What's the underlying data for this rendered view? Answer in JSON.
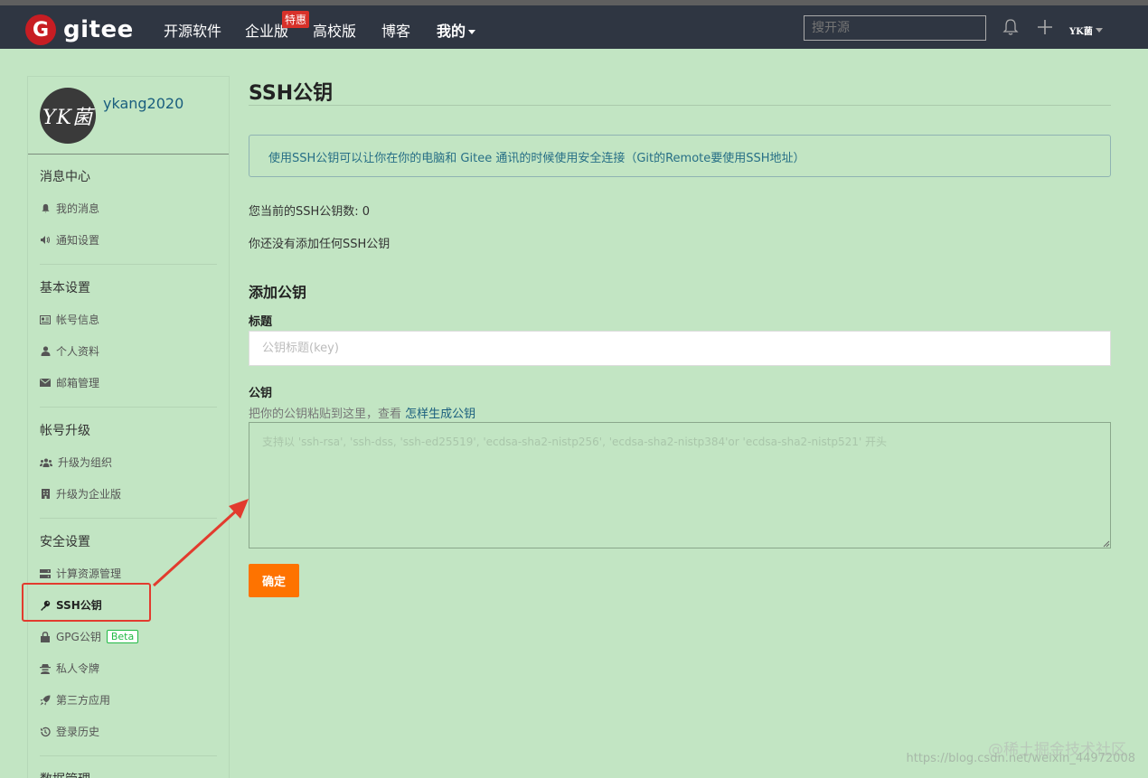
{
  "nav": {
    "logo_letter": "G",
    "logo_text": "gitee",
    "items": [
      "开源软件",
      "企业版",
      "高校版",
      "博客",
      "我的"
    ],
    "enterprise_badge": "特惠",
    "search_placeholder": "搜开源",
    "avatar_text": "YK菌"
  },
  "sidebar": {
    "avatar_text": "YK菌",
    "username": "ykang2020",
    "sections": [
      {
        "title": "消息中心",
        "items": [
          {
            "label": "我的消息",
            "icon": "bell-icon"
          },
          {
            "label": "通知设置",
            "icon": "speaker-icon"
          }
        ]
      },
      {
        "title": "基本设置",
        "items": [
          {
            "label": "帐号信息",
            "icon": "id-card-icon"
          },
          {
            "label": "个人资料",
            "icon": "user-icon"
          },
          {
            "label": "邮箱管理",
            "icon": "envelope-icon"
          }
        ]
      },
      {
        "title": "帐号升级",
        "items": [
          {
            "label": "升级为组织",
            "icon": "users-icon"
          },
          {
            "label": "升级为企业版",
            "icon": "building-icon"
          }
        ]
      },
      {
        "title": "安全设置",
        "items": [
          {
            "label": "计算资源管理",
            "icon": "server-icon"
          },
          {
            "label": "SSH公钥",
            "icon": "key-icon"
          },
          {
            "label": "GPG公钥",
            "icon": "lock-icon",
            "badge": "Beta"
          },
          {
            "label": "私人令牌",
            "icon": "spy-icon"
          },
          {
            "label": "第三方应用",
            "icon": "rocket-icon"
          },
          {
            "label": "登录历史",
            "icon": "history-icon"
          }
        ]
      },
      {
        "title": "数据管理",
        "items": []
      }
    ]
  },
  "main": {
    "title": "SSH公钥",
    "info": "使用SSH公钥可以让你在你的电脑和 Gitee 通讯的时候使用安全连接（Git的Remote要使用SSH地址）",
    "count_text": "您当前的SSH公钥数: 0",
    "none_text": "你还没有添加任何SSH公钥",
    "add_title": "添加公钥",
    "title_label": "标题",
    "title_placeholder": "公钥标题(key)",
    "key_label": "公钥",
    "hint_prefix": "把你的公钥粘贴到这里，查看 ",
    "hint_link": "怎样生成公钥",
    "key_placeholder": "支持以 'ssh-rsa', 'ssh-dss, 'ssh-ed25519', 'ecdsa-sha2-nistp256', 'ecdsa-sha2-nistp384'or 'ecdsa-sha2-nistp521' 开头",
    "submit": "确定"
  },
  "watermark": {
    "line1": "@稀土掘金技术社区",
    "line2": "https://blog.csdn.net/weixin_44972008"
  },
  "colors": {
    "background": "#c2e5c3",
    "navbar": "#2f3642",
    "brand": "#c71d23",
    "submit": "#fe7300",
    "highlight": "#e23b2e"
  }
}
